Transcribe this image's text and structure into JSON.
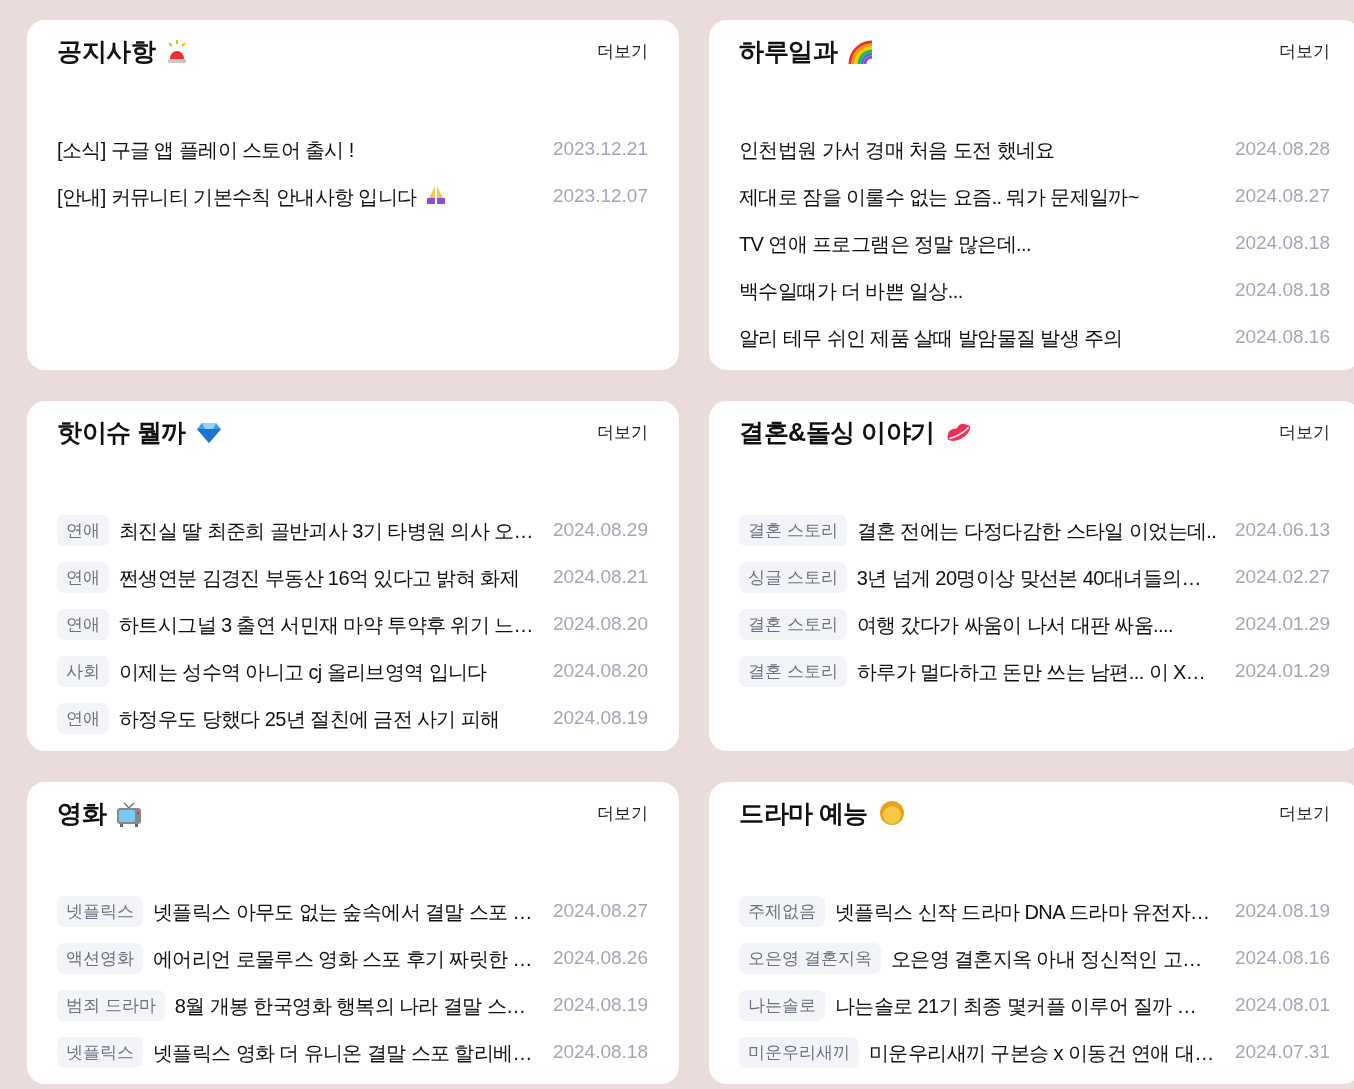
{
  "boards": [
    {
      "title": "공지사항",
      "more": "더보기",
      "posts": [
        {
          "kind": "plain",
          "title": "[소식] 구글 앱 플레이 스토어 출시 !",
          "date": "2023.12.21"
        },
        {
          "kind": "icon",
          "title": "[안내] 커뮤니티 기본수칙 안내사항 입니다",
          "date": "2023.12.07"
        }
      ]
    },
    {
      "title": "하루일과",
      "more": "더보기",
      "posts": [
        {
          "title": "인천법원 가서 경매 처음 도전 했네요",
          "date": "2024.08.28"
        },
        {
          "title": "제대로 잠을 이룰수 없는 요즘.. 뭐가 문제일까~",
          "date": "2024.08.27"
        },
        {
          "title": "TV 연애 프로그램은 정말 많은데...",
          "date": "2024.08.18"
        },
        {
          "title": "백수일때가 더 바쁜 일상...",
          "date": "2024.08.18"
        },
        {
          "title": "알리 테무 쉬인 제품 살때 발암물질 발생 주의",
          "date": "2024.08.16"
        }
      ]
    },
    {
      "title": "핫이슈 뭘까",
      "more": "더보기",
      "posts": [
        {
          "tag": "연애",
          "title": "최진실 딸 최준희 골반괴사 3기 타병원 의사 오…",
          "date": "2024.08.29"
        },
        {
          "tag": "연애",
          "title": "쩐생연분 김경진 부동산 16억 있다고 밝혀 화제",
          "date": "2024.08.21"
        },
        {
          "tag": "연애",
          "title": "하트시그널 3 출연 서민재 마약 투약후 위기 느…",
          "date": "2024.08.20"
        },
        {
          "tag": "사회",
          "title": "이제는 성수역 아니고 cj 올리브영역 입니다",
          "date": "2024.08.20"
        },
        {
          "tag": "연애",
          "title": "하정우도 당했다 25년 절친에 금전 사기 피해",
          "date": "2024.08.19"
        }
      ]
    },
    {
      "title": "결혼&돌싱 이야기",
      "more": "더보기",
      "posts": [
        {
          "tag": "결혼 스토리",
          "title": "결혼 전에는 다정다감한 스타일 이었는데..",
          "date": "2024.06.13"
        },
        {
          "tag": "싱글 스토리",
          "title": "3년 넘게 20명이상 맞선본 40대녀들의…",
          "date": "2024.02.27"
        },
        {
          "tag": "결혼 스토리",
          "title": "여행 갔다가 싸움이 나서 대판 싸움....",
          "date": "2024.01.29"
        },
        {
          "tag": "결혼 스토리",
          "title": "하루가 멀다하고 돈만 쓰는 남편... 이 X…",
          "date": "2024.01.29"
        }
      ]
    },
    {
      "title": "영화",
      "more": "더보기",
      "posts": [
        {
          "tag": "넷플릭스",
          "title": "넷플릭스 아무도 없는 숲속에서 결말 스포 …",
          "date": "2024.08.27"
        },
        {
          "tag": "액션영화",
          "title": "에어리언 로물루스 영화 스포 후기 짜릿한 …",
          "date": "2024.08.26"
        },
        {
          "tag": "범죄 드라마",
          "title": "8월 개봉 한국영화 행복의 나라 결말 스…",
          "date": "2024.08.19"
        },
        {
          "tag": "넷플릭스",
          "title": "넷플릭스 영화 더 유니온 결말 스포 할리베…",
          "date": "2024.08.18"
        }
      ]
    },
    {
      "title": "드라마 예능",
      "more": "더보기",
      "posts": [
        {
          "tag": "주제없음",
          "title": "넷플릭스 신작 드라마 DNA 드라마 유전자…",
          "date": "2024.08.19"
        },
        {
          "tag": "오은영 결혼지옥",
          "title": "오은영 결혼지옥 아내 정신적인 고…",
          "date": "2024.08.16"
        },
        {
          "tag": "나는솔로",
          "title": "나는솔로 21기 최종 몇커플 이루어 질까 …",
          "date": "2024.08.01"
        },
        {
          "tag": "미운우리새끼",
          "title": "미운우리새끼 구본승 x 이동건 연애 대…",
          "date": "2024.07.31"
        }
      ]
    }
  ]
}
